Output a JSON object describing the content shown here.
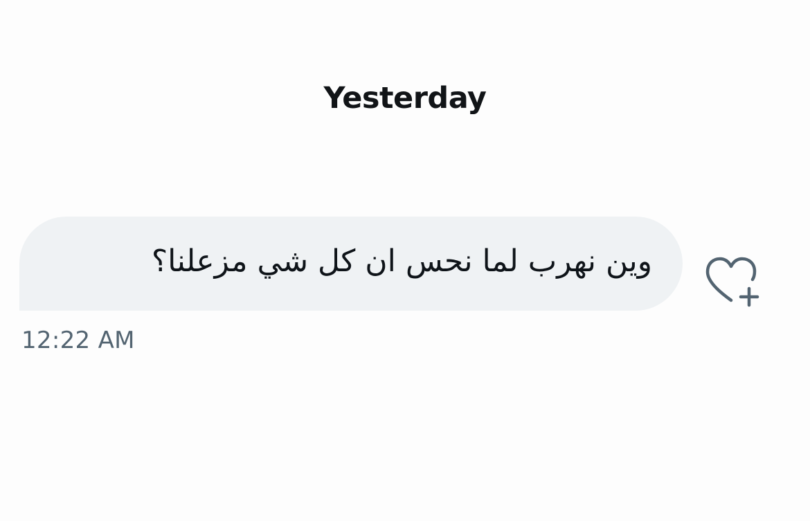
{
  "conversation": {
    "day_divider": "Yesterday",
    "messages": [
      {
        "text": "وين نهرب لما نحس ان كل شي مزعلنا؟",
        "time": "12:22 AM",
        "reaction_icon": "heart-plus-icon"
      }
    ]
  },
  "colors": {
    "background": "#fdfdfd",
    "bubble": "#eff2f4",
    "text_primary": "#0f1419",
    "text_secondary": "#536471",
    "icon": "#536471"
  }
}
